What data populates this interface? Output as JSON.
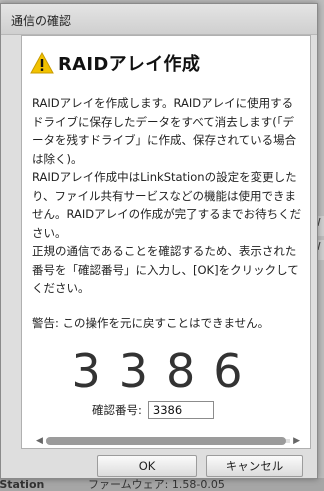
{
  "background": {
    "bottom_left_text": "kStation",
    "bottom_right_text": "ファームウェア: 1.58-0.05",
    "side_letters": [
      "W",
      "W"
    ]
  },
  "dialog": {
    "title": "通信の確認",
    "heading": "RAIDアレイ作成",
    "message": "RAIDアレイを作成します。RAIDアレイに使用するドライブに保存したデータをすべて消去します(「データを残すドライブ」に作成、保存されている場合は除く)。\nRAIDアレイ作成中はLinkStationの設定を変更したり、ファイル共有サービスなどの機能は使用できません。RAIDアレイの作成が完了するまでお待ちください。\n正規の通信であることを確認するため、表示された番号を「確認番号」に入力し、[OK]をクリックしてください。",
    "warning": "警告: この操作を元に戻すことはできません。",
    "code": "3386",
    "confirm_label": "確認番号:",
    "confirm_value": "3386",
    "ok_label": "OK",
    "cancel_label": "キャンセル",
    "icons": {
      "warning": "warning-triangle-icon"
    },
    "colors": {
      "warning_fill": "#f2c200"
    }
  }
}
